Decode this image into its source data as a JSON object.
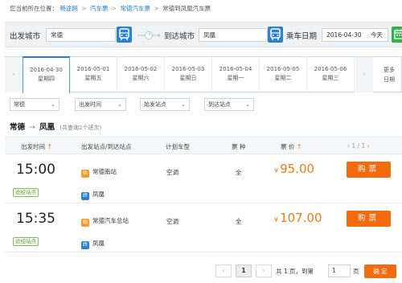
{
  "breadcrumb": {
    "prefix": "您当前所在位置：",
    "items": [
      "畅途网",
      "汽车票",
      "常德汽车票"
    ],
    "current": "常德到凤凰汽车票",
    "separator": ">"
  },
  "search": {
    "from_label": "出发城市",
    "from_value": "常德",
    "to_label": "到达城市",
    "to_value": "凤凰",
    "date_label": "乘车日期",
    "date_value": "2016-04-30",
    "date_day": "今天"
  },
  "dates": {
    "prev_arrow": "‹",
    "next_arrow": "›",
    "items": [
      {
        "date": "2016-04-30",
        "weekday": "星期四",
        "active": true
      },
      {
        "date": "2016-05-01",
        "weekday": "星期五"
      },
      {
        "date": "2016-05-02",
        "weekday": "星期六"
      },
      {
        "date": "2016-05-03",
        "weekday": "星期日"
      },
      {
        "date": "2016-05-04",
        "weekday": "星期一"
      },
      {
        "date": "2016-05-05",
        "weekday": "星期二"
      },
      {
        "date": "2016-05-06",
        "weekday": "星期三"
      }
    ],
    "more_line1": "更多",
    "more_line2": "日期"
  },
  "filters": [
    {
      "value": "常德"
    },
    {
      "value": "出发时间"
    },
    {
      "value": "始发站点"
    },
    {
      "value": "到达站点"
    }
  ],
  "route": {
    "from": "常德",
    "arrow": "→",
    "to": "凤凰",
    "count_prefix": "(共查询",
    "count": "2",
    "count_suffix": "个班次)"
  },
  "table": {
    "headers": {
      "time": "出发时间",
      "station": "出发站点/到达站点",
      "type": "计划车型",
      "kind": "票 种",
      "price": "票 价"
    },
    "sort_arrow": "↑",
    "mini_pager": "‹ 1 / 1 ›",
    "rows": [
      {
        "time": "15:00",
        "via": "途经站点",
        "start_station": "常德南站",
        "start_tag": "始",
        "end_station": "凤凰",
        "end_tag": "终",
        "type": "空调",
        "kind": "全",
        "currency": "¥",
        "price": "95.00",
        "buy": "购票"
      },
      {
        "time": "15:35",
        "via": "途经站点",
        "start_station": "常德汽车总站",
        "start_tag": "始",
        "end_station": "凤凰",
        "end_tag": "终",
        "type": "空调",
        "kind": "全",
        "currency": "¥",
        "price": "107.00",
        "buy": "购票"
      }
    ]
  },
  "pagination": {
    "prev": "‹",
    "current": "1",
    "next": "›",
    "total_text": "共 1 页，到第",
    "input_value": "1",
    "page_unit": "页",
    "confirm": "确 定"
  },
  "colors": {
    "accent_blue": "#2a82d6",
    "accent_orange": "#f36a0f",
    "calendar_green": "#36b04c"
  }
}
